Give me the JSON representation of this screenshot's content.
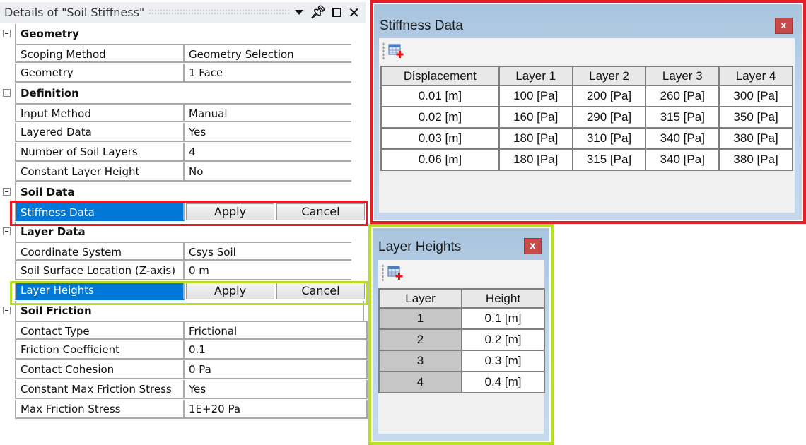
{
  "details_pane": {
    "title": "Details of \"Soil Stiffness\"",
    "icons": [
      "dropdown-icon",
      "pin-icon",
      "maximize-icon",
      "close-icon"
    ],
    "categories": [
      {
        "label": "Geometry",
        "rows": [
          {
            "name": "Scoping Method",
            "value": "Geometry Selection"
          },
          {
            "name": "Geometry",
            "value": "1 Face"
          }
        ]
      },
      {
        "label": "Definition",
        "rows": [
          {
            "name": "Input Method",
            "value": "Manual"
          },
          {
            "name": "Layered Data",
            "value": "Yes"
          },
          {
            "name": "Number of Soil Layers",
            "value": "4"
          },
          {
            "name": "Constant Layer Height",
            "value": "No"
          }
        ]
      },
      {
        "label": "Soil Data",
        "rows": [
          {
            "name": "Stiffness Data",
            "apply": "Apply",
            "cancel": "Cancel"
          }
        ]
      },
      {
        "label": "Layer Data",
        "rows": [
          {
            "name": "Coordinate System",
            "value": "Csys Soil"
          },
          {
            "name": "Soil Surface Location (Z-axis)",
            "value": "0 m"
          },
          {
            "name": "Layer Heights",
            "apply": "Apply",
            "cancel": "Cancel"
          }
        ]
      },
      {
        "label": "Soil Friction",
        "rows": [
          {
            "name": "Contact Type",
            "value": "Frictional"
          },
          {
            "name": "Friction Coefficient",
            "value": "0.1"
          },
          {
            "name": "Contact Cohesion",
            "value": "0 Pa"
          },
          {
            "name": "Constant Max Friction Stress",
            "value": "Yes"
          },
          {
            "name": "Max Friction Stress",
            "value": "1E+20 Pa"
          }
        ]
      }
    ]
  },
  "stiffness_dialog": {
    "title": "Stiffness Data",
    "close_label": "x",
    "columns": [
      "Displacement",
      "Layer 1",
      "Layer 2",
      "Layer 3",
      "Layer 4"
    ],
    "rows": [
      [
        "0.01 [m]",
        "100 [Pa]",
        "200 [Pa]",
        "260 [Pa]",
        "300 [Pa]"
      ],
      [
        "0.02 [m]",
        "160 [Pa]",
        "290 [Pa]",
        "315 [Pa]",
        "350 [Pa]"
      ],
      [
        "0.03 [m]",
        "180 [Pa]",
        "310 [Pa]",
        "340 [Pa]",
        "380 [Pa]"
      ],
      [
        "0.06 [m]",
        "180 [Pa]",
        "315 [Pa]",
        "340 [Pa]",
        "380 [Pa]"
      ]
    ]
  },
  "layer_heights_dialog": {
    "title": "Layer Heights",
    "close_label": "x",
    "columns": [
      "Layer",
      "Height"
    ],
    "rows": [
      [
        "1",
        "0.1 [m]"
      ],
      [
        "2",
        "0.2 [m]"
      ],
      [
        "3",
        "0.3 [m]"
      ],
      [
        "4",
        "0.4 [m]"
      ]
    ]
  },
  "highlight_colors": {
    "stiffness": "#e81c24",
    "layer_heights": "#b7e021",
    "selected_row": "#0078d7"
  }
}
